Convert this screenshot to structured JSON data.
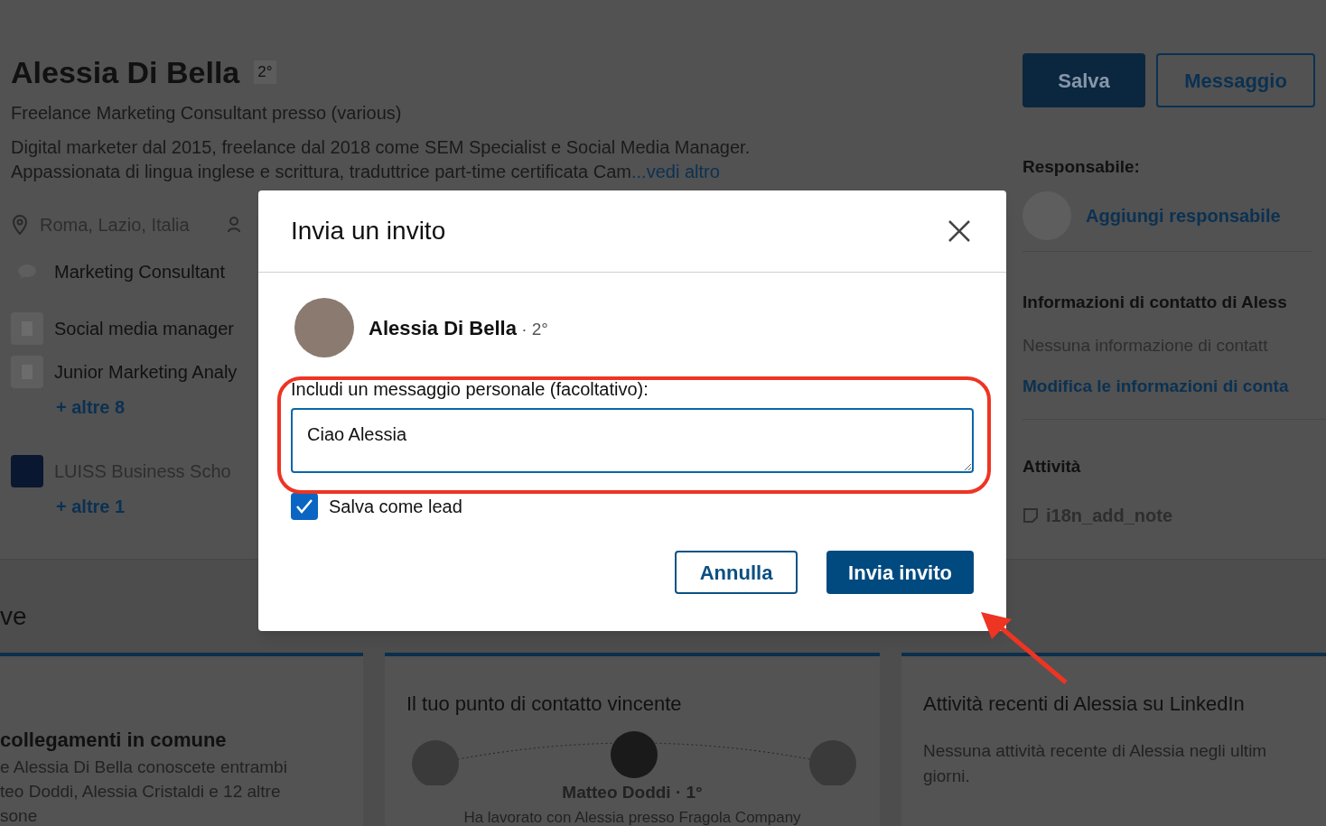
{
  "profile": {
    "name": "Alessia Di Bella",
    "degree": "2°",
    "headline": "Freelance Marketing Consultant presso (various)",
    "summary": [
      "Digital marketer dal 2015, freelance dal 2018 come SEM Specialist e Social Media Manager.",
      "Appassionata di lingua inglese e scrittura, traduttrice part-time certificata Cam"
    ],
    "see_more": "...vedi altro",
    "location": "Roma, Lazio, Italia",
    "details": [
      {
        "kind": "chat",
        "text": "Marketing Consultant"
      },
      {
        "kind": "company",
        "text": "Social media manager"
      },
      {
        "kind": "company",
        "text": "Junior Marketing Analy",
        "more": "+ altre 8"
      },
      {
        "kind": "school",
        "text": "LUISS Business Scho",
        "more": "+ altre 1"
      }
    ]
  },
  "actions": [
    {
      "label": "Salva",
      "kind": "primary"
    },
    {
      "label": "Messaggio",
      "kind": "secondary"
    }
  ],
  "sidebar": {
    "owner_heading": "Responsabile:",
    "owner_link": "Aggiungi responsabile",
    "contact_heading": "Informazioni di contatto di Aless",
    "contact_empty": "Nessuna informazione di contatt",
    "contact_link": "Modifica le informazioni di conta",
    "activity_heading": "Attività",
    "activity_item": "i18n_add_note"
  },
  "section_title": "ve",
  "cards": [
    {
      "kind": "connections",
      "title": "collegamenti in comune",
      "lines": [
        "e Alessia Di Bella conoscete entrambi",
        "teo Doddi, Alessia Cristaldi e 12 altre",
        "sone"
      ]
    },
    {
      "kind": "path",
      "title": "Il tuo punto di contatto vincente",
      "person": "Matteo Doddi · 1°",
      "note": "Ha lavorato con Alessia presso Fragola Company"
    },
    {
      "kind": "activity",
      "title": "Attività recenti di Alessia su LinkedIn",
      "lines": [
        "Nessuna attività recente di Alessia negli ultim",
        "giorni."
      ]
    }
  ],
  "dialog": {
    "title": "Invia un invito",
    "name": "Alessia Di Bella",
    "degree": " · 2°",
    "message_label": "Includi un messaggio personale (facoltativo):",
    "message": "Ciao Alessia",
    "save_as_lead": {
      "label": "Salva come lead",
      "checked": true
    },
    "buttons": [
      {
        "label": "Annulla",
        "kind": "secondary"
      },
      {
        "label": "Invia invito",
        "kind": "primary"
      }
    ]
  }
}
